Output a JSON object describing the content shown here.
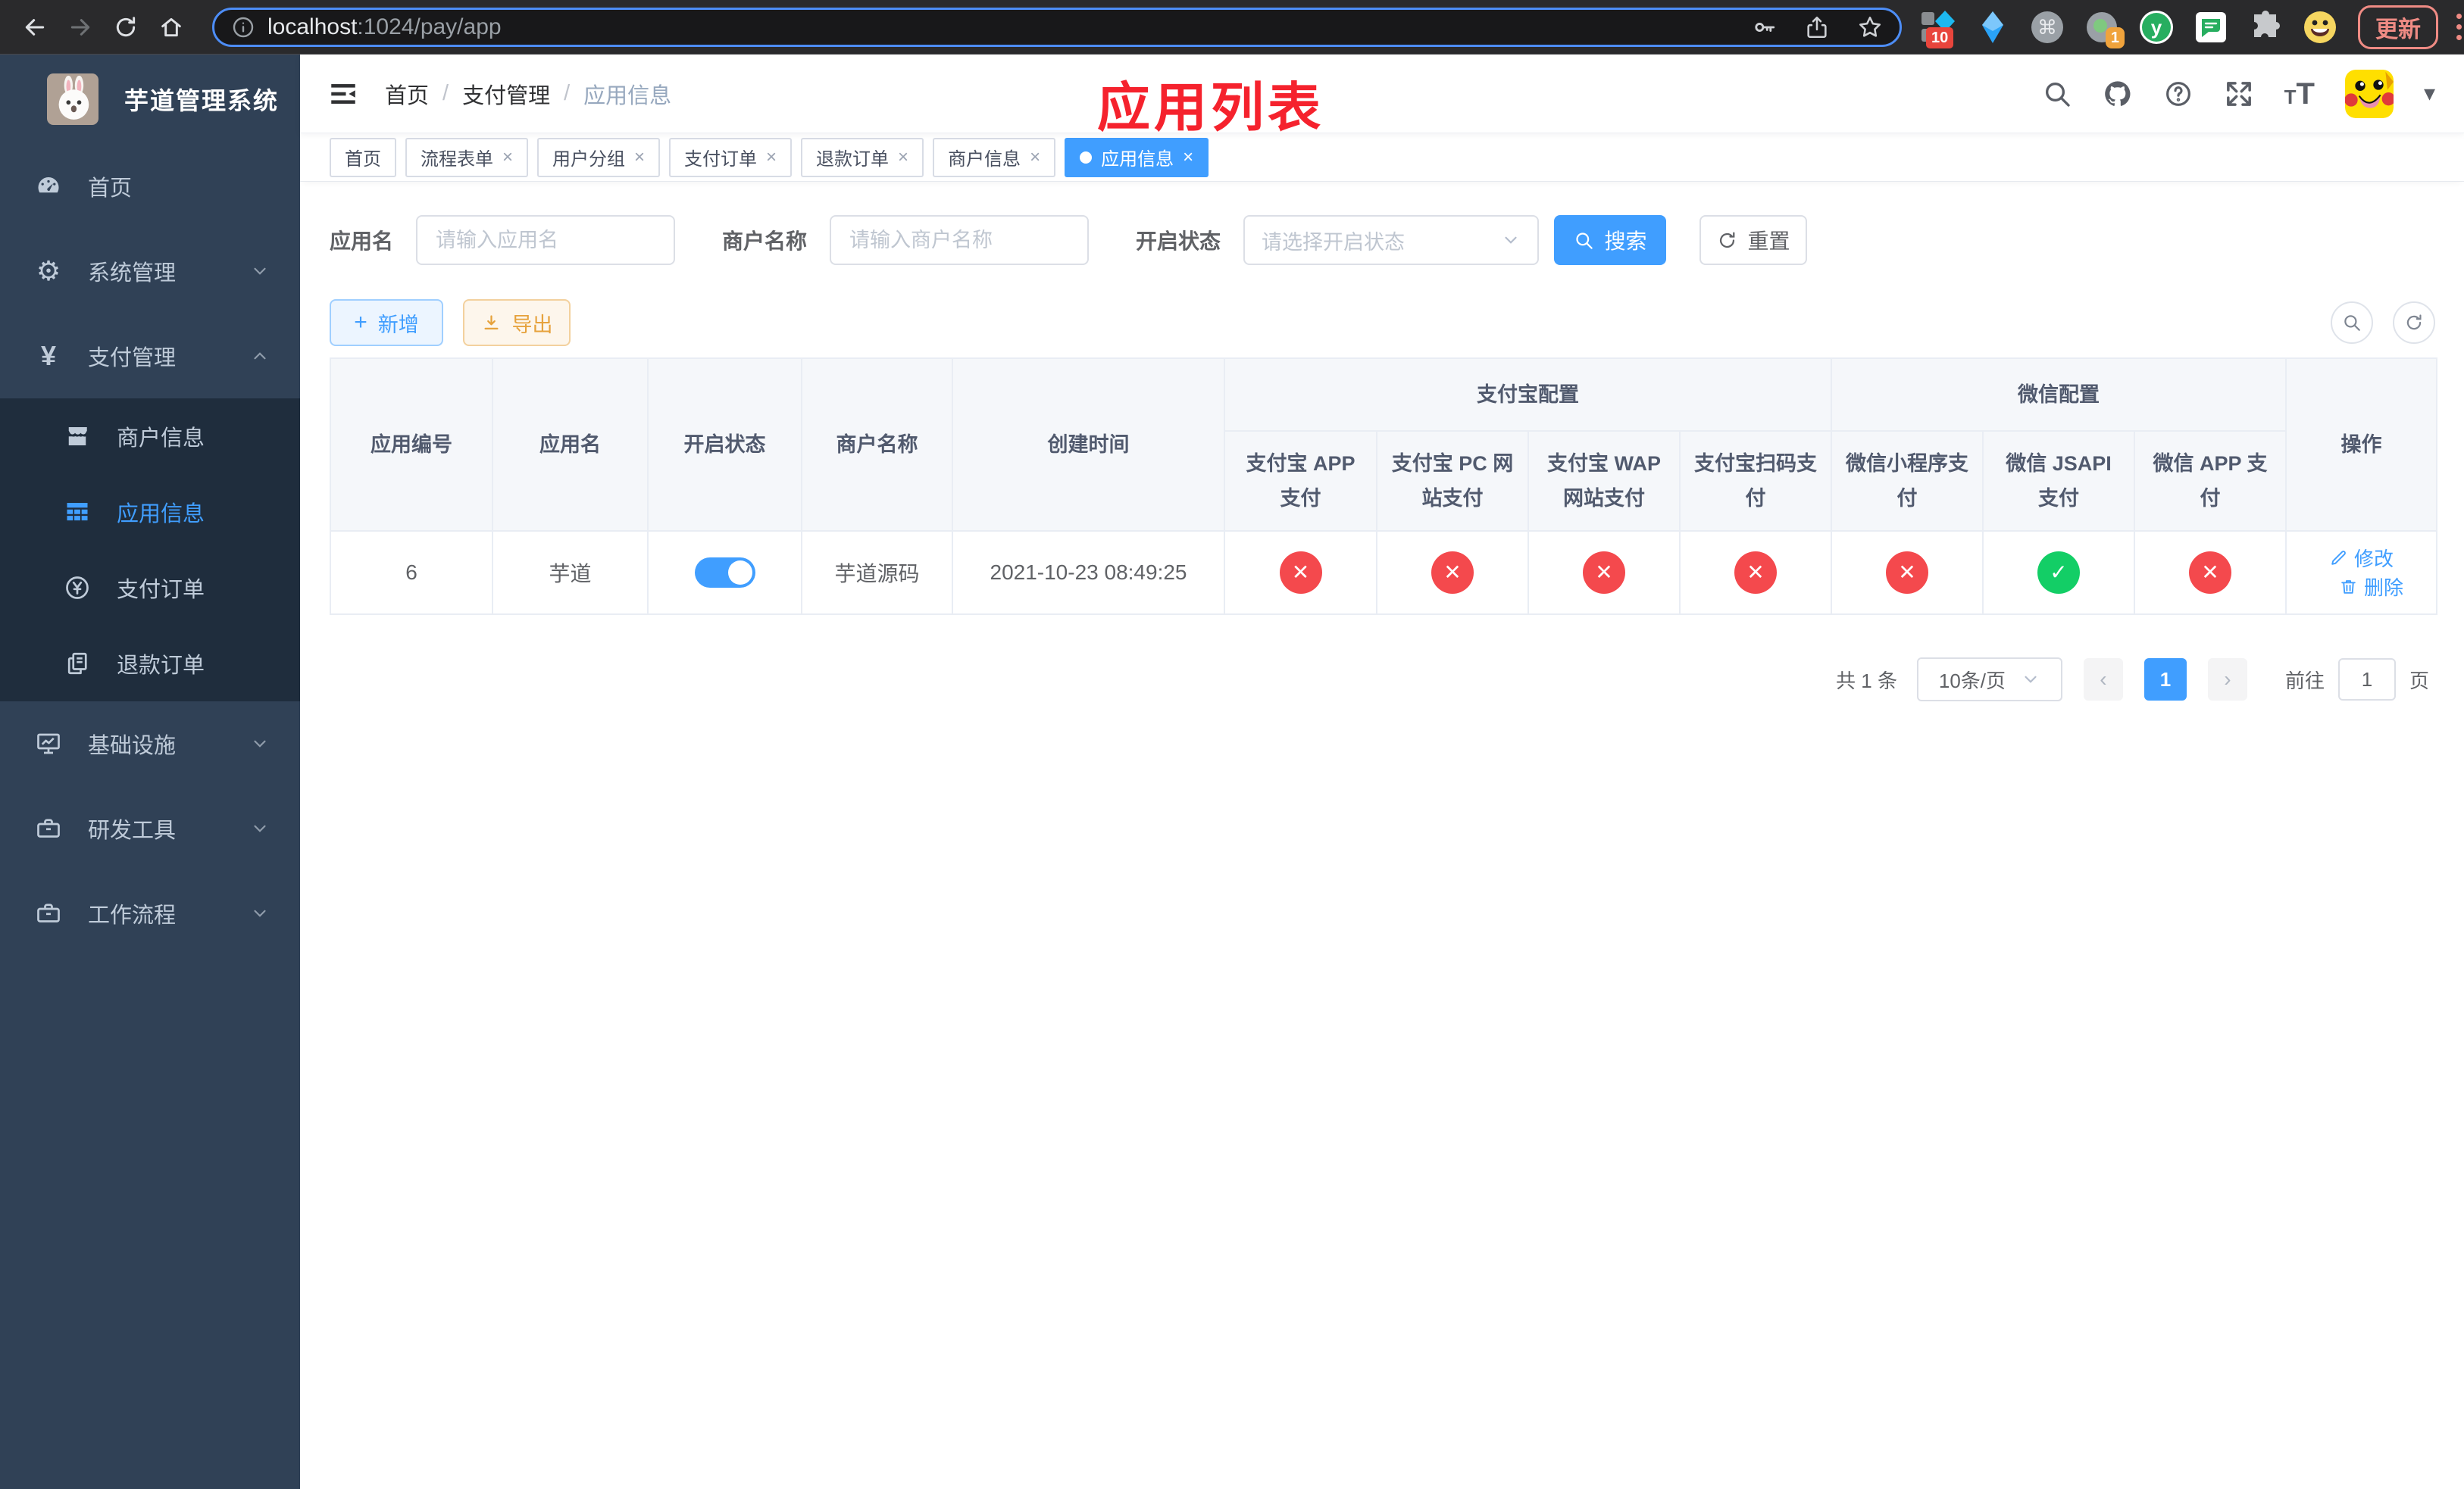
{
  "browser": {
    "url_host": "localhost",
    "url_rest": ":1024/pay/app",
    "update_label": "更新",
    "ext_badge_10": "10",
    "ext_badge_1": "1",
    "ext_y_label": "y",
    "ext_command_glyph": "⌘"
  },
  "sidebar": {
    "title": "芋道管理系统",
    "items": [
      {
        "label": "首页"
      },
      {
        "label": "系统管理"
      },
      {
        "label": "支付管理"
      },
      {
        "label": "商户信息"
      },
      {
        "label": "应用信息"
      },
      {
        "label": "支付订单"
      },
      {
        "label": "退款订单"
      },
      {
        "label": "基础设施"
      },
      {
        "label": "研发工具"
      },
      {
        "label": "工作流程"
      }
    ]
  },
  "breadcrumb": {
    "home": "首页",
    "section": "支付管理",
    "current": "应用信息",
    "separator": "/"
  },
  "annotation": {
    "title": "应用列表"
  },
  "tags": [
    {
      "label": "首页",
      "closable": false,
      "active": false
    },
    {
      "label": "流程表单",
      "closable": true,
      "active": false
    },
    {
      "label": "用户分组",
      "closable": true,
      "active": false
    },
    {
      "label": "支付订单",
      "closable": true,
      "active": false
    },
    {
      "label": "退款订单",
      "closable": true,
      "active": false
    },
    {
      "label": "商户信息",
      "closable": true,
      "active": false
    },
    {
      "label": "应用信息",
      "closable": true,
      "active": true
    }
  ],
  "filters": {
    "app_name_label": "应用名",
    "app_name_placeholder": "请输入应用名",
    "merchant_label": "商户名称",
    "merchant_placeholder": "请输入商户名称",
    "status_label": "开启状态",
    "status_placeholder": "请选择开启状态",
    "search_label": "搜索",
    "reset_label": "重置"
  },
  "toolbar": {
    "add_label": "新增",
    "export_label": "导出"
  },
  "table": {
    "group_headers": {
      "alipay": "支付宝配置",
      "wechat": "微信配置"
    },
    "columns": [
      "应用编号",
      "应用名",
      "开启状态",
      "商户名称",
      "创建时间",
      "支付宝 APP 支付",
      "支付宝 PC 网站支付",
      "支付宝 WAP 网站支付",
      "支付宝扫码支付",
      "微信小程序支付",
      "微信 JSAPI 支付",
      "微信 APP 支付",
      "操作"
    ],
    "row": {
      "id": "6",
      "name": "芋道",
      "enabled": true,
      "merchant": "芋道源码",
      "created": "2021-10-23 08:49:25",
      "statuses": [
        "no",
        "no",
        "no",
        "no",
        "no",
        "yes",
        "no"
      ],
      "edit_label": "修改",
      "delete_label": "删除"
    }
  },
  "pagination": {
    "total": "共 1 条",
    "page_size": "10条/页",
    "page": "1",
    "goto_label": "前往",
    "goto_value": "1",
    "page_suffix": "页"
  },
  "icons": {
    "search": "magnifier",
    "github": "octocat",
    "help": "question-circle",
    "fullscreen": "expand-arrows",
    "font_size": "tT",
    "hamburger": "indent-bars",
    "status_yes": "check",
    "status_no": "cross",
    "edit": "pen",
    "delete": "trash"
  },
  "colors": {
    "accent": "#409eff",
    "danger": "#f4494d",
    "success": "#13ce66",
    "warning": "#e6a23c",
    "annotation": "#f5222d",
    "sidebar": "#304156",
    "submenu": "#1f2d3d",
    "table_header_bg": "#f5f7fa"
  }
}
